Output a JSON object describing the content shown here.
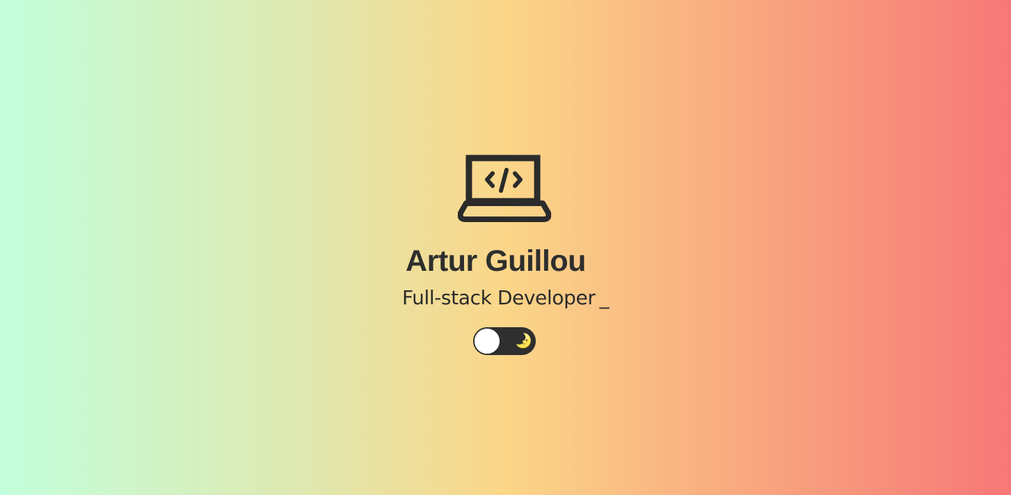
{
  "profile": {
    "name": "Artur Guillou",
    "role": "Full-stack Developer",
    "cursor": "_"
  },
  "logo": {
    "icon": "laptop-code-icon",
    "code_glyph": "</>"
  },
  "theme_toggle": {
    "icon": "moon-icon",
    "glyph": "🌛",
    "state": "light",
    "enabled": false
  },
  "colors": {
    "gradient_start": "#c3ffdc",
    "gradient_mid": "#fbd688",
    "gradient_end": "#f77878",
    "text": "#2b2b2b",
    "toggle_track": "#2f2f2f",
    "toggle_knob": "#ffffff",
    "moon": "#f6c945"
  }
}
